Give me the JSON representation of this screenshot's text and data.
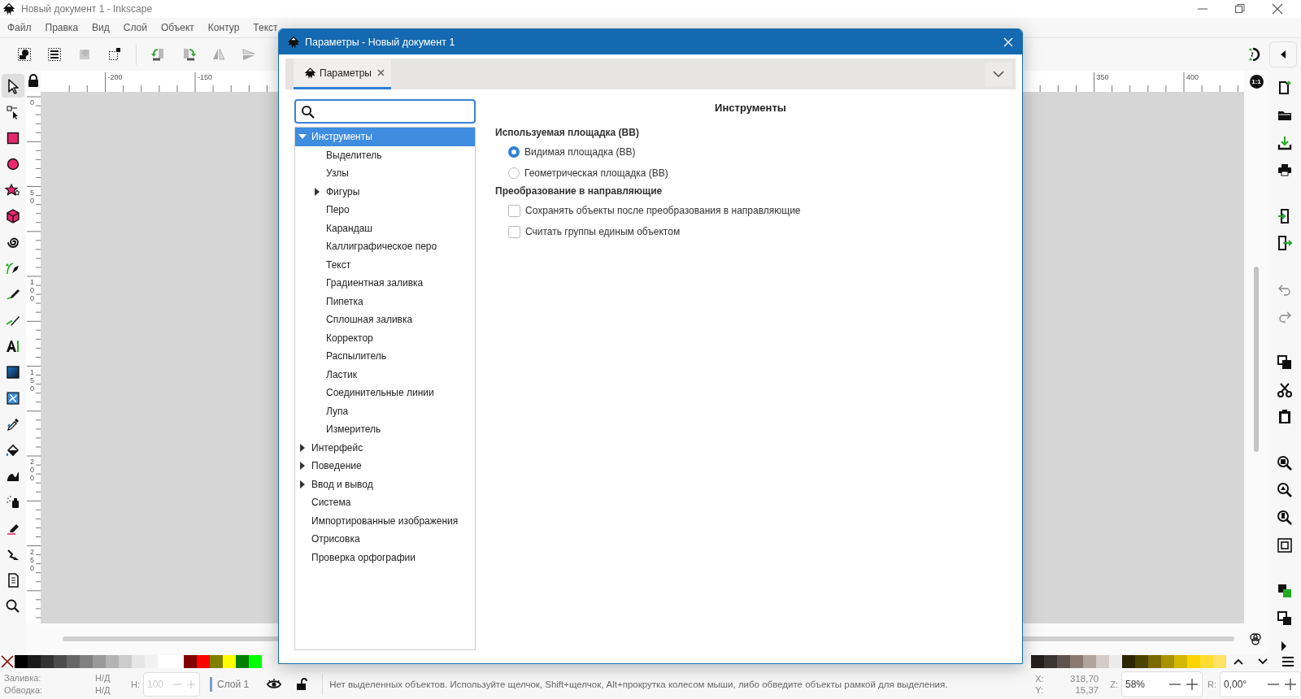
{
  "window": {
    "title": "Новый документ 1 - Inkscape"
  },
  "menu": [
    "Файл",
    "Правка",
    "Вид",
    "Слой",
    "Объект",
    "Контур",
    "Текст"
  ],
  "tools": [
    {
      "selected": true
    },
    {
      "selected": false
    },
    {
      "selected": false
    },
    {
      "selected": false
    },
    {
      "selected": false
    },
    {
      "selected": false
    },
    {
      "selected": false
    },
    {
      "selected": false
    },
    {
      "selected": false
    },
    {
      "selected": false
    },
    {
      "selected": false
    },
    {
      "selected": false
    },
    {
      "selected": false
    },
    {
      "selected": false
    },
    {
      "selected": false
    },
    {
      "selected": false
    },
    {
      "selected": false
    },
    {
      "selected": false
    },
    {
      "selected": false
    },
    {
      "selected": false
    },
    {
      "selected": false
    }
  ],
  "zoom_corner": "1:1",
  "rulers": {
    "horizontal": [
      "-200",
      "-150",
      "350",
      "400"
    ],
    "vertical": [
      "0",
      "50",
      "100",
      "150",
      "200",
      "250"
    ]
  },
  "dialog": {
    "title": "Параметры - Новый документ 1",
    "tab": {
      "label": "Параметры",
      "selected": true
    },
    "tree": [
      {
        "label": "Инструменты",
        "selected": true,
        "expanded": true,
        "children": [
          {
            "label": "Выделитель",
            "selected": false
          },
          {
            "label": "Узлы",
            "selected": false
          },
          {
            "label": "Фигуры",
            "selected": false,
            "expanded": false
          },
          {
            "label": "Перо",
            "selected": false
          },
          {
            "label": "Карандаш",
            "selected": false
          },
          {
            "label": "Каллиграфическое перо",
            "selected": false
          },
          {
            "label": "Текст",
            "selected": false
          },
          {
            "label": "Градиентная заливка",
            "selected": false
          },
          {
            "label": "Пипетка",
            "selected": false
          },
          {
            "label": "Сплошная заливка",
            "selected": false
          },
          {
            "label": "Корректор",
            "selected": false
          },
          {
            "label": "Распылитель",
            "selected": false
          },
          {
            "label": "Ластик",
            "selected": false
          },
          {
            "label": "Соединительные линии",
            "selected": false
          },
          {
            "label": "Лупа",
            "selected": false
          },
          {
            "label": "Измеритель",
            "selected": false
          }
        ]
      },
      {
        "label": "Интерфейс",
        "selected": false,
        "expanded": false
      },
      {
        "label": "Поведение",
        "selected": false,
        "expanded": false
      },
      {
        "label": "Ввод и вывод",
        "selected": false,
        "expanded": false
      },
      {
        "label": "Система",
        "selected": false
      },
      {
        "label": "Импортированные изображения",
        "selected": false
      },
      {
        "label": "Отрисовка",
        "selected": false
      },
      {
        "label": "Проверка орфографии",
        "selected": false
      }
    ],
    "page_title": "Инструменты",
    "sections": [
      {
        "title": "Используемая площадка (BB)",
        "options": [
          {
            "kind": "radio",
            "label": "Видимая площадка (BB)",
            "selected": true
          },
          {
            "kind": "radio",
            "label": "Геометрическая площадка (BB)",
            "selected": false
          }
        ]
      },
      {
        "title": "Преобразование в направляющие",
        "options": [
          {
            "kind": "checkbox",
            "label": "Сохранять объекты после преобразования в направляющие",
            "checked": false
          },
          {
            "kind": "checkbox",
            "label": "Считать группы единым объектом",
            "checked": false
          }
        ]
      }
    ]
  },
  "palette": {
    "left": [
      {
        "color": "#000000"
      },
      {
        "color": "#1a1a1a"
      },
      {
        "color": "#333333"
      },
      {
        "color": "#4d4d4d"
      },
      {
        "color": "#666666"
      },
      {
        "color": "#808080"
      },
      {
        "color": "#999999"
      },
      {
        "color": "#b3b3b3"
      },
      {
        "color": "#cccccc"
      },
      {
        "color": "#e6e6e6"
      },
      {
        "color": "#f2f2f2"
      },
      {
        "color": "#ffffff"
      },
      {
        "color": "#ffffff"
      },
      {
        "color": "#800000"
      },
      {
        "color": "#ff0000"
      },
      {
        "color": "#808000"
      },
      {
        "color": "#ffff00"
      },
      {
        "color": "#008000"
      },
      {
        "color": "#00ff00"
      }
    ],
    "right": [
      {
        "color": "#241f1c"
      },
      {
        "color": "#3d3533"
      },
      {
        "color": "#5e524d"
      },
      {
        "color": "#8a7a70"
      },
      {
        "color": "#b0a59c"
      },
      {
        "color": "#d4ccc6"
      },
      {
        "color": "#ebebeb"
      },
      {
        "color": "#2b2600"
      },
      {
        "color": "#4d4400"
      },
      {
        "color": "#7a6a00"
      },
      {
        "color": "#a89200"
      },
      {
        "color": "#d4b800"
      },
      {
        "color": "#ffd500"
      },
      {
        "color": "#ffdd33"
      },
      {
        "color": "#ffe266"
      }
    ]
  },
  "status": {
    "fill_label": "Заливка:",
    "fill_value": "Н/Д",
    "stroke_label": "Обводка:",
    "stroke_value": "Н/Д",
    "opacity_label": "Н:",
    "opacity_value": "100",
    "opacity_disabled": true,
    "layer": "Слой 1",
    "message": "Нет выделенных объектов. Используйте щелчок, Shift+щелчок, Alt+прокрутка колесом мыши, либо обведите объекты рамкой для выделения.",
    "x_label": "X:",
    "x_value": "318,70",
    "y_label": "Y:",
    "y_value": "15,37",
    "zoom_label": "Z:",
    "zoom_value": "58%",
    "rotate_label": "R:",
    "rotate_value": "0,00°"
  }
}
